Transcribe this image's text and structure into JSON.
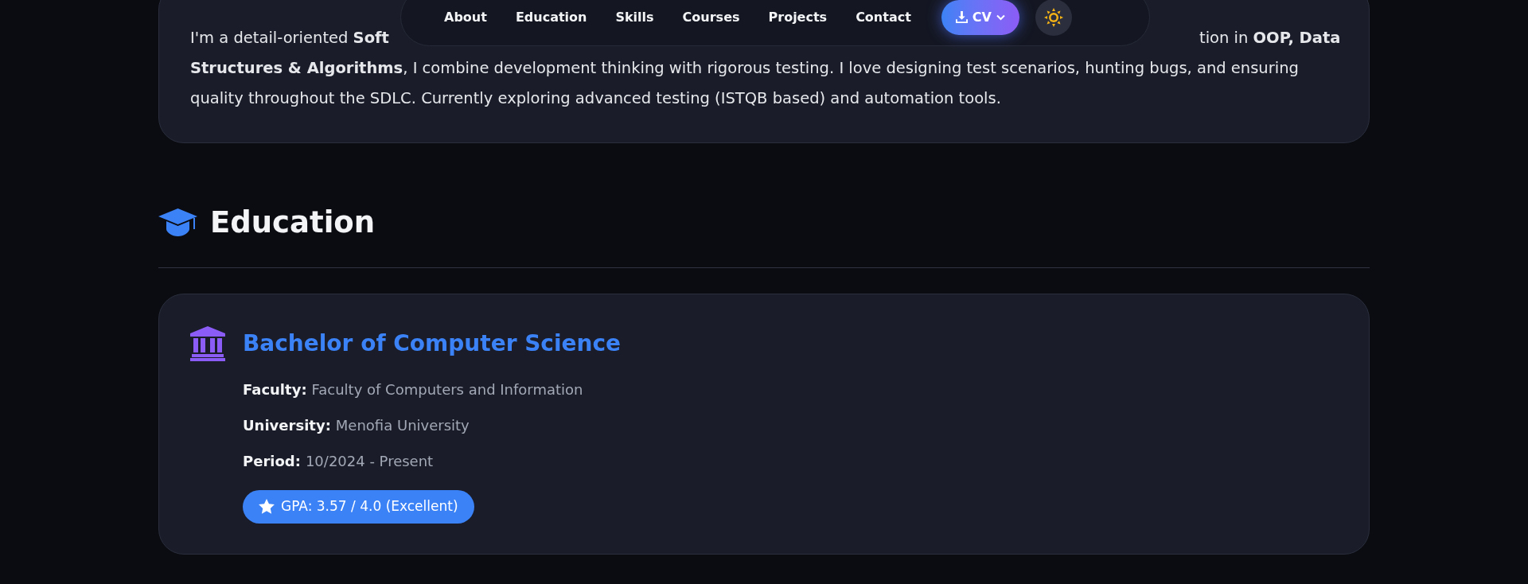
{
  "about": {
    "lines": [
      [
        "I'm a detail-oriented **Soft**",
        "tion in **OOP, Data**"
      ],
      [
        "**Structures & Algorithms**, I combine development thinking with rigorous testing. I love designing test scenarios, hunting bugs, and ensuring"
      ],
      [
        "quality throughout the SDLC. Currently exploring advanced testing (ISTQB based) and automation tools."
      ]
    ]
  },
  "nav": {
    "links": [
      "About",
      "Education",
      "Skills",
      "Courses",
      "Projects",
      "Contact"
    ],
    "cv_button": "CV"
  },
  "education": {
    "heading": "Education",
    "entries": [
      {
        "title": "Bachelor of Computer Science",
        "fields": [
          {
            "label": "Faculty:",
            "value": "Faculty of Computers and Information"
          },
          {
            "label": "University:",
            "value": "Menofia University"
          },
          {
            "label": "Period:",
            "value": "10/2024 - Present"
          }
        ],
        "badge": "GPA: 3.57 / 4.0 (Excellent)"
      }
    ]
  }
}
